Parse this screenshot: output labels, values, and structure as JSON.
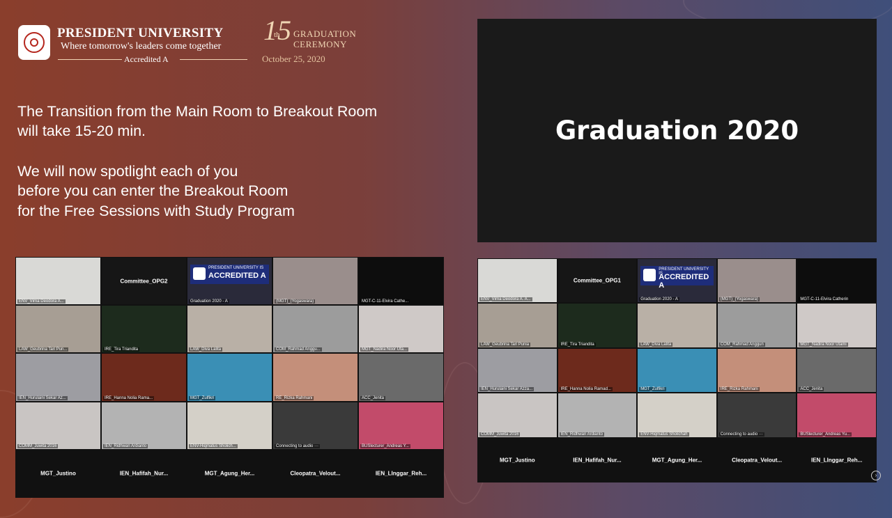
{
  "header": {
    "university": "PRESIDENT UNIVERSITY",
    "tagline": "Where tomorrow's leaders come together",
    "accredited": "Accredited A",
    "edition_number": "15",
    "edition_suffix": "th",
    "ceremony_line1": "GRADUATION",
    "ceremony_line2": "CEREMONY",
    "date": "October 25, 2020"
  },
  "message": {
    "line1": "The Transition from the Main Room to Breakout Room",
    "line2": "will take 15-20 min.",
    "line3": "We will now spotlight each of you",
    "line4": "before you can enter the Breakout Room",
    "line5": "for the Free Sessions with Study Program"
  },
  "video": {
    "title": "Graduation 2020"
  },
  "accredited_badge": {
    "line1": "PRESIDENT UNIVERSITY IS",
    "line2": "ACCREDITED A"
  },
  "gallery_left": {
    "committee": "Committee_OPG2",
    "names": [
      "ENV_Virna Deodora A...",
      "",
      "Graduation 2020 - A",
      "(MGT)_(Yogaswara)",
      "MGT-C-11-Elvira Cathe...",
      "LAW_Geubrina Tari Pun...",
      "IRE_Tira Triandita",
      "LAW_Diva Lalita",
      "COM_Rahmad Anggu...",
      "MGT_Nadira Noor Uta...",
      "IEN_Hurulaini Sekar Az...",
      "IRE_Hanna Nolia Rama...",
      "MGT_Zulfikri",
      "RE_Rizka Rahmani",
      "ACC_Jenita",
      "COMM_Juwita 2016",
      "IEN_Ridhwan Ardianto",
      "ENV-Hiqmatus Sholich...",
      "Connecting to audio ···",
      "BUSlecturer_Andreas Y..."
    ],
    "bottom": [
      "MGT_Justino",
      "IEN_Hafifah_Nur...",
      "MGT_Agung_Her...",
      "Cleopatra_Velout...",
      "IEN_LInggar_Reh..."
    ]
  },
  "gallery_right": {
    "committee": "Committee_OPG1",
    "names": [
      "ENV_Virna Deodora A. A...",
      "",
      "Graduation 2020 - A",
      "(MGT)_(Yogaswara)",
      "MGT-C-11-Elvira Catherin",
      "LAW_Geubrina Tari Punia",
      "IRE_Tira Triandita",
      "LAW_Diva Lalita",
      "COM_Rahmad Anggun",
      "MGT_Nadira Noor Utami",
      "IEN_Hurulaini Sekar Azza...",
      "IRE_Hanna Nolia Ramad...",
      "MGT_Zulfikri",
      "IRE_Rizka Rahmani",
      "ACC_Jenita",
      "COMM_Juwita 2016",
      "IEN_Ridhwan Ardianto",
      "ENV-Hiqmatus Sholichah",
      "Connecting to audio ···",
      "BUSlecturer_Andreas Yu..."
    ],
    "bottom": [
      "MGT_Justino",
      "IEN_Hafifah_Nur...",
      "MGT_Agung_Her...",
      "Cleopatra_Velout...",
      "IEN_LInggar_Reh..."
    ]
  },
  "tile_colors": [
    "#d9d9d6",
    "#161616",
    "#2a2a3a",
    "#9a8e8c",
    "#0d0d0d",
    "#a79e94",
    "#1d2b1d",
    "#b9b0a6",
    "#9c9c9c",
    "#cfc9c7",
    "#9d9da2",
    "#6d2a1c",
    "#3a8fb5",
    "#c48f7a",
    "#6a6a6a",
    "#c9c5c3",
    "#b3b3b3",
    "#d4d0c8",
    "#3a3a3a",
    "#c24b6a"
  ]
}
